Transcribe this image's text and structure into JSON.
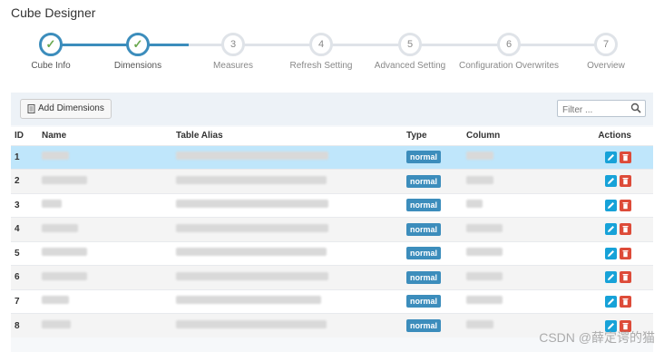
{
  "page": {
    "title": "Cube Designer"
  },
  "wizard": {
    "steps": [
      {
        "marker": "✓",
        "label": "Cube Info",
        "done": true
      },
      {
        "marker": "✓",
        "label": "Dimensions",
        "done": true
      },
      {
        "marker": "3",
        "label": "Measures",
        "done": false
      },
      {
        "marker": "4",
        "label": "Refresh Setting",
        "done": false
      },
      {
        "marker": "5",
        "label": "Advanced Setting",
        "done": false
      },
      {
        "marker": "6",
        "label": "Configuration Overwrites",
        "done": false
      },
      {
        "marker": "7",
        "label": "Overview",
        "done": false
      }
    ]
  },
  "toolbar": {
    "add_label": "Add Dimensions",
    "filter_placeholder": "Filter ..."
  },
  "table": {
    "headers": {
      "id": "ID",
      "name": "Name",
      "alias": "Table Alias",
      "type": "Type",
      "column": "Column",
      "actions": "Actions"
    },
    "rows": [
      {
        "id": "1",
        "type": "normal",
        "selected": true
      },
      {
        "id": "2",
        "type": "normal"
      },
      {
        "id": "3",
        "type": "normal"
      },
      {
        "id": "4",
        "type": "normal"
      },
      {
        "id": "5",
        "type": "normal"
      },
      {
        "id": "6",
        "type": "normal"
      },
      {
        "id": "7",
        "type": "normal"
      },
      {
        "id": "8",
        "type": "normal"
      }
    ]
  },
  "watermark": {
    "text": "CSDN @薛定谔的猫"
  },
  "colors": {
    "primary": "#3c8dbc",
    "edit": "#17a2d8",
    "delete": "#dd4b39",
    "selected_row": "#bfe6fb"
  }
}
